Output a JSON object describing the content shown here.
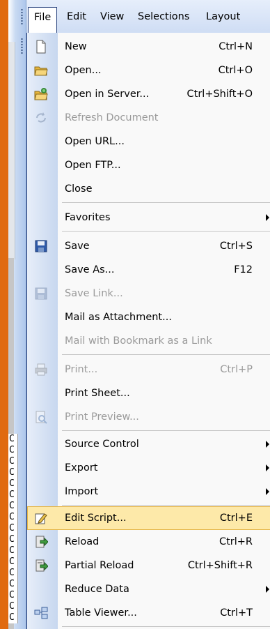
{
  "menubar": {
    "items": [
      {
        "label": "File",
        "active": true
      },
      {
        "label": "Edit",
        "active": false
      },
      {
        "label": "View",
        "active": false
      },
      {
        "label": "Selections",
        "active": false
      },
      {
        "label": "Layout",
        "active": false
      }
    ]
  },
  "colors": {
    "accent_border": "#2c4680",
    "highlight_bg": "#fde9a9",
    "highlight_border": "#e5b548",
    "disabled_text": "#9a9a9a",
    "app_edge": "#e06a10"
  },
  "side_cells": [
    "C",
    "C",
    "C",
    "C",
    "C",
    "C",
    "C",
    "C",
    "C",
    "C",
    "C",
    "C",
    "C",
    "C",
    "C",
    "C",
    "C",
    "C",
    "C",
    "C",
    "C",
    "C",
    "C",
    "C",
    "C",
    "C",
    "C",
    "C",
    "C",
    "C",
    "C"
  ],
  "file_menu": {
    "items": [
      {
        "label": "New",
        "shortcut": "Ctrl+N",
        "icon": "new-document-icon",
        "disabled": false
      },
      {
        "label": "Open...",
        "shortcut": "Ctrl+O",
        "icon": "open-folder-icon",
        "disabled": false
      },
      {
        "label": "Open in Server...",
        "shortcut": "Ctrl+Shift+O",
        "icon": "server-folder-icon",
        "disabled": false
      },
      {
        "label": "Refresh Document",
        "shortcut": "",
        "icon": "refresh-icon",
        "disabled": true
      },
      {
        "label": "Open URL...",
        "shortcut": "",
        "icon": "",
        "disabled": false
      },
      {
        "label": "Open FTP...",
        "shortcut": "",
        "icon": "",
        "disabled": false
      },
      {
        "label": "Close",
        "shortcut": "",
        "icon": "",
        "disabled": false
      },
      {
        "label": "Favorites",
        "shortcut": "",
        "icon": "",
        "disabled": false,
        "submenu": true
      },
      {
        "label": "Save",
        "shortcut": "Ctrl+S",
        "icon": "save-icon",
        "disabled": false
      },
      {
        "label": "Save As...",
        "shortcut": "F12",
        "icon": "",
        "disabled": false
      },
      {
        "label": "Save Link...",
        "shortcut": "",
        "icon": "save-link-icon",
        "disabled": true
      },
      {
        "label": "Mail as Attachment...",
        "shortcut": "",
        "icon": "",
        "disabled": false
      },
      {
        "label": "Mail with Bookmark as a Link",
        "shortcut": "",
        "icon": "",
        "disabled": true
      },
      {
        "label": "Print...",
        "shortcut": "Ctrl+P",
        "icon": "printer-icon",
        "disabled": true
      },
      {
        "label": "Print Sheet...",
        "shortcut": "",
        "icon": "",
        "disabled": false
      },
      {
        "label": "Print Preview...",
        "shortcut": "",
        "icon": "print-preview-icon",
        "disabled": true
      },
      {
        "label": "Source Control",
        "shortcut": "",
        "icon": "",
        "disabled": false,
        "submenu": true
      },
      {
        "label": "Export",
        "shortcut": "",
        "icon": "",
        "disabled": false,
        "submenu": true
      },
      {
        "label": "Import",
        "shortcut": "",
        "icon": "",
        "disabled": false,
        "submenu": true
      },
      {
        "label": "Edit Script...",
        "shortcut": "Ctrl+E",
        "icon": "edit-script-icon",
        "disabled": false,
        "highlighted": true
      },
      {
        "label": "Reload",
        "shortcut": "Ctrl+R",
        "icon": "reload-icon",
        "disabled": false
      },
      {
        "label": "Partial Reload",
        "shortcut": "Ctrl+Shift+R",
        "icon": "partial-reload-icon",
        "disabled": false
      },
      {
        "label": "Reduce Data",
        "shortcut": "",
        "icon": "",
        "disabled": false,
        "submenu": true
      },
      {
        "label": "Table Viewer...",
        "shortcut": "Ctrl+T",
        "icon": "table-viewer-icon",
        "disabled": false
      }
    ]
  }
}
